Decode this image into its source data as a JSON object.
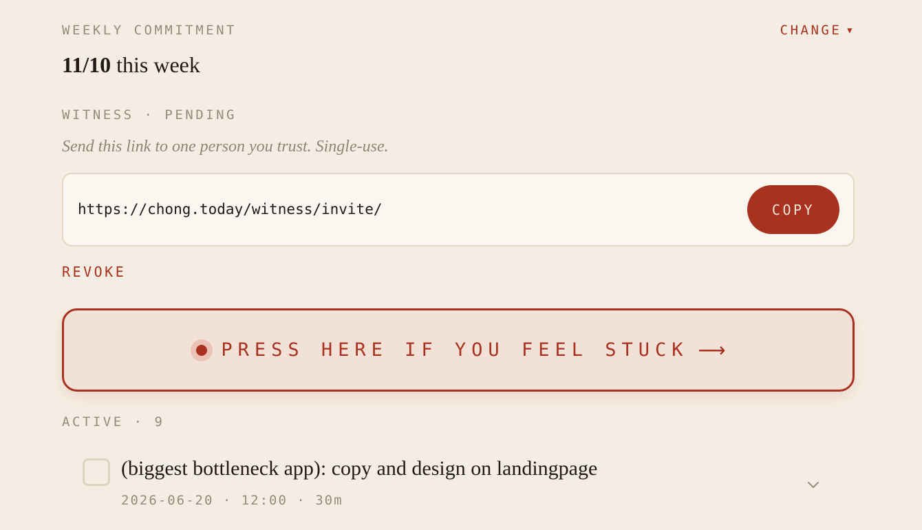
{
  "commitment": {
    "label": "WEEKLY COMMITMENT",
    "change_label": "CHANGE",
    "change_icon": "caret-down-icon",
    "count": "11/10",
    "suffix": " this week"
  },
  "witness": {
    "label": "WITNESS · PENDING",
    "hint": "Send this link to one person you trust. Single-use.",
    "link": "https://chong.today/witness/invite/",
    "copy_label": "COPY",
    "revoke_label": "REVOKE"
  },
  "stuck": {
    "label": "PRESS HERE IF YOU FEEL STUCK",
    "arrow": "⟶",
    "icon": "pulse-dot-icon"
  },
  "active": {
    "label": "ACTIVE · 9",
    "tasks": [
      {
        "title": "(biggest bottleneck app): copy and design on landingpage",
        "meta": "2026-06-20 · 12:00 · 30m",
        "expand_icon": "chevron-down-icon"
      }
    ]
  },
  "colors": {
    "background": "#f5ede3",
    "accent": "#a8321f",
    "muted": "#968a7d",
    "text": "#1f1a16",
    "card": "#fbf6ef",
    "stuck_bg": "#f2e1d7"
  }
}
